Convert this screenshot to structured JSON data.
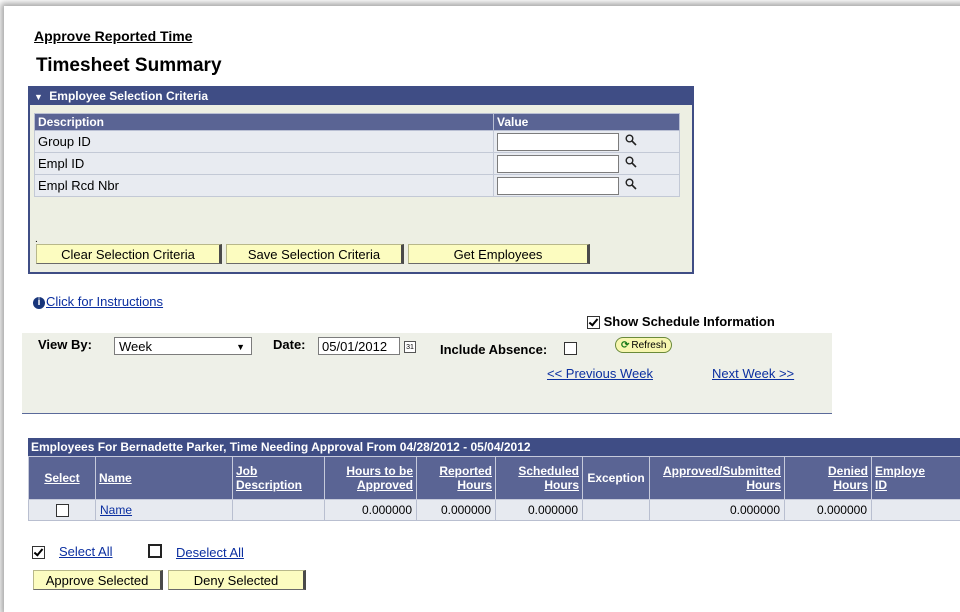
{
  "page": {
    "title": "Approve Reported Time",
    "subtitle": "Timesheet Summary"
  },
  "criteria": {
    "header": "Employee Selection Criteria",
    "col_description": "Description",
    "col_value": "Value",
    "rows": [
      {
        "label": "Group ID",
        "value": ""
      },
      {
        "label": "Empl ID",
        "value": ""
      },
      {
        "label": "Empl Rcd Nbr",
        "value": ""
      }
    ],
    "dot": ".",
    "buttons": {
      "clear": "Clear Selection Criteria",
      "save": "Save Selection Criteria",
      "get": "Get Employees"
    }
  },
  "instructions_link": "Click for Instructions",
  "options": {
    "show_schedule_label": "Show Schedule Information",
    "show_schedule_checked": true,
    "view_by_label": "View By:",
    "view_by_value": "Week",
    "date_label": "Date:",
    "date_value": "05/01/2012",
    "calendar_glyph": "31",
    "include_absence_label": "Include Absence:",
    "include_absence_checked": false,
    "refresh_label": "Refresh",
    "prev_week": "<< Previous Week",
    "next_week": "Next Week >>"
  },
  "grid": {
    "title": "Employees For Bernadette Parker, Time Needing Approval From 04/28/2012 - 05/04/2012",
    "columns": {
      "select": "Select",
      "name": "Name",
      "job_desc_1": "Job",
      "job_desc_2": "Description",
      "hours_approve_1": "Hours to be",
      "hours_approve_2": "Approved",
      "reported_1": "Reported",
      "reported_2": "Hours",
      "scheduled_1": "Scheduled",
      "scheduled_2": "Hours",
      "exception": "Exception",
      "approved_submitted_1": "Approved/Submitted",
      "approved_submitted_2": "Hours",
      "denied_1": "Denied",
      "denied_2": "Hours",
      "employee_id_1": "Employe",
      "employee_id_2": "ID"
    },
    "rows": [
      {
        "name": "Name",
        "job_description": "",
        "hours_to_be_approved": "0.000000",
        "reported_hours": "0.000000",
        "scheduled_hours": "0.000000",
        "exception": "",
        "approved_submitted_hours": "0.000000",
        "denied_hours": "0.000000",
        "employee_id": ""
      }
    ]
  },
  "actions": {
    "select_all": "Select All",
    "deselect_all": "Deselect All",
    "approve_selected": "Approve Selected",
    "deny_selected": "Deny Selected"
  }
}
